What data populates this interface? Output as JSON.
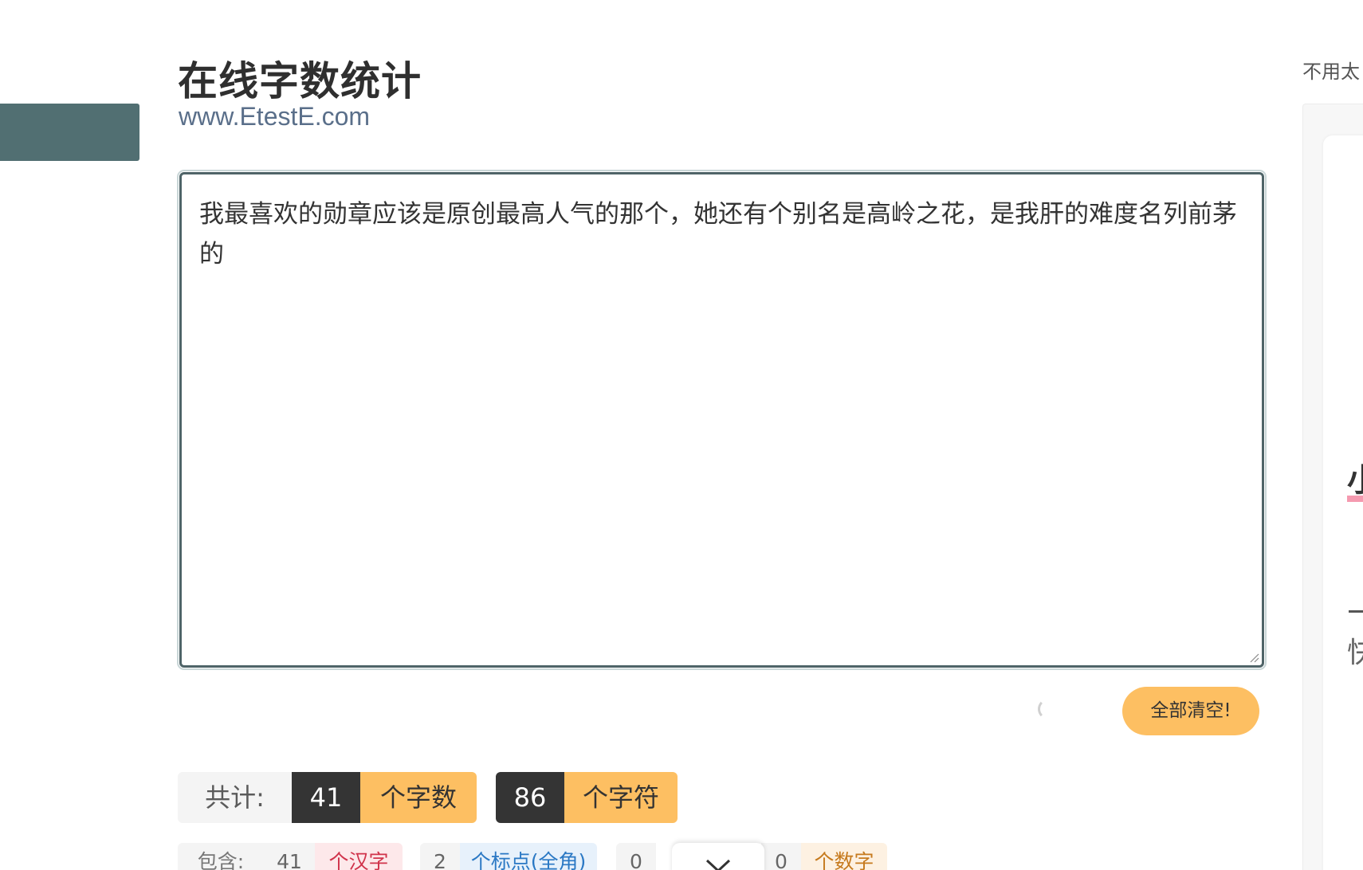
{
  "header": {
    "title": "在线字数统计",
    "subtitle": "www.EtestE.com"
  },
  "editor": {
    "value": "我最喜欢的勋章应该是原创最高人气的那个，她还有个别名是高岭之花，是我肝的难度名列前茅的"
  },
  "actions": {
    "clear_label": "全部清空!"
  },
  "totals": {
    "label": "共计:",
    "word_count": "41",
    "word_unit": "个字数",
    "char_count": "86",
    "char_unit": "个字符"
  },
  "breakdown": {
    "label": "包含:",
    "hanzi_count": "41",
    "hanzi_unit": "个汉字",
    "punct_count": "2",
    "punct_unit": "个标点(全角)",
    "hidden_count": "0",
    "digit_count": "0",
    "digit_unit": "个数字"
  },
  "sidebar": {
    "tagline": "不用太",
    "card_glyph_1": "小",
    "card_glyph_2": "快"
  },
  "colors": {
    "accent": "#fdbf62",
    "dark": "#343434",
    "border": "#4f6468",
    "side_tab": "#516f72"
  },
  "icons": {
    "collapse": "chevron-down-icon",
    "loading": "spinner-icon",
    "resize": "resize-grip-icon"
  }
}
